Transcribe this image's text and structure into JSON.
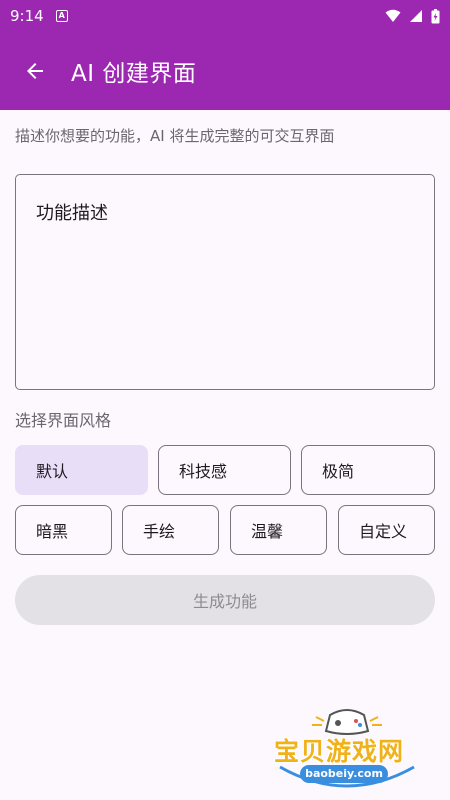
{
  "status_bar": {
    "time": "9:14",
    "notif": "A"
  },
  "app_bar": {
    "title": "AI 创建界面"
  },
  "hint": "描述你想要的功能，AI 将生成完整的可交互界面",
  "description": {
    "placeholder": "功能描述",
    "value": ""
  },
  "style_section": {
    "label": "选择界面风格",
    "options": [
      "默认",
      "科技感",
      "极简",
      "暗黑",
      "手绘",
      "温馨",
      "自定义"
    ],
    "selected": "默认"
  },
  "generate_button": {
    "label": "生成功能",
    "enabled": false
  },
  "watermark": {
    "text": "宝贝游戏网",
    "url": "baobeiy.com"
  },
  "colors": {
    "primary": "#9c27b0",
    "background": "#fcf8fd",
    "chip_selected": "#e8def8",
    "button_disabled": "#e4e1e6",
    "outline": "#79747e"
  }
}
